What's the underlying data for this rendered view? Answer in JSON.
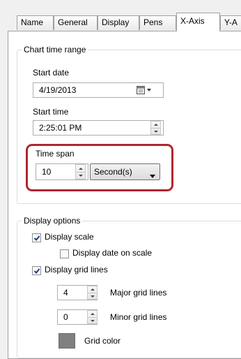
{
  "tabs": [
    {
      "label": "Name"
    },
    {
      "label": "General"
    },
    {
      "label": "Display"
    },
    {
      "label": "Pens"
    },
    {
      "label": "X-Axis"
    },
    {
      "label": "Y-A"
    }
  ],
  "active_tab": "X-Axis",
  "chart_time_range": {
    "title": "Chart time range",
    "start_date_label": "Start date",
    "start_date_value": "4/19/2013",
    "start_time_label": "Start time",
    "start_time_value": "2:25:01 PM",
    "time_span_label": "Time span",
    "time_span_value": "10",
    "time_span_unit": "Second(s)"
  },
  "display_options": {
    "title": "Display options",
    "display_scale_label": "Display scale",
    "display_scale_checked": true,
    "display_date_on_scale_label": "Display date on scale",
    "display_date_on_scale_checked": false,
    "display_grid_lines_label": "Display grid lines",
    "display_grid_lines_checked": true,
    "major_grid_lines_value": "4",
    "major_grid_lines_label": "Major grid lines",
    "minor_grid_lines_value": "0",
    "minor_grid_lines_label": "Minor grid lines",
    "grid_color_label": "Grid color",
    "grid_color": "#808080"
  },
  "colors": {
    "highlight": "#b0262f",
    "checkmark": "#1d3b8c"
  }
}
